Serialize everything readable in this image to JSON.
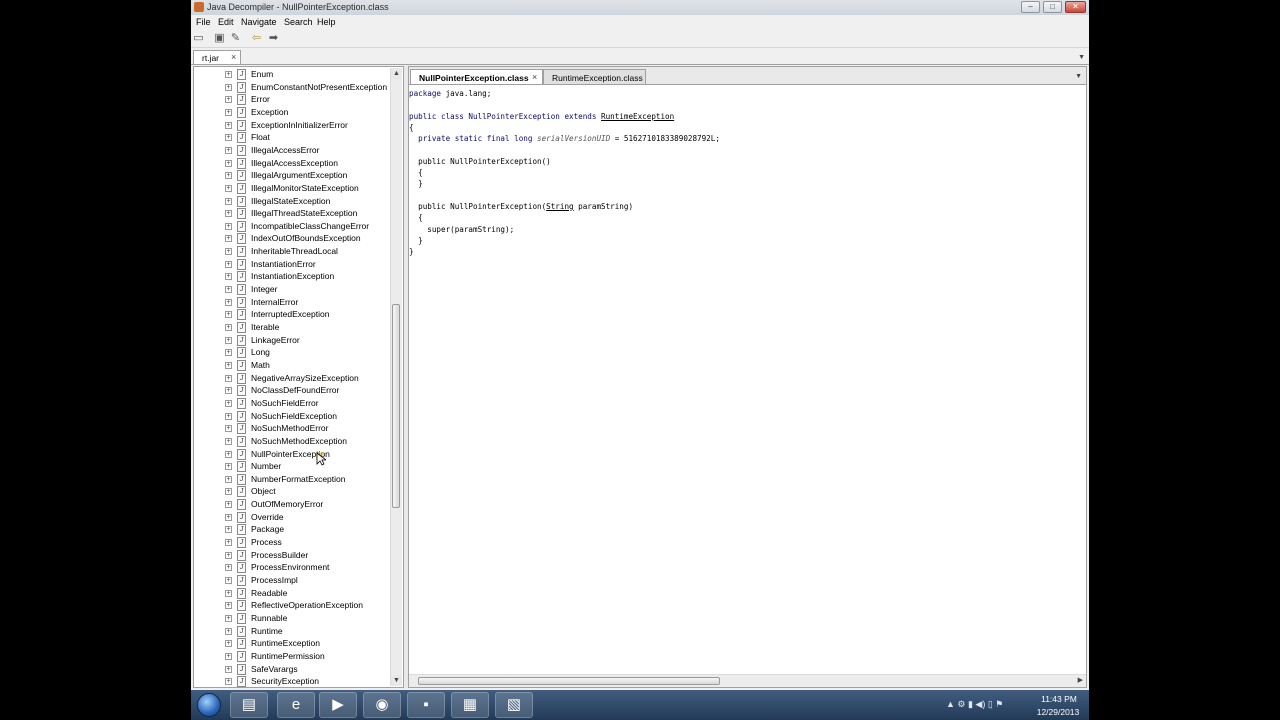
{
  "window": {
    "title": "Java Decompiler - NullPointerException.class"
  },
  "window_controls": {
    "minimize": "–",
    "maximize": "□",
    "close": "✕"
  },
  "menu": [
    "File",
    "Edit",
    "Navigate",
    "Search",
    "Help"
  ],
  "toolbar": [
    {
      "icon": "open-file-icon",
      "glyph": "▭"
    },
    {
      "icon": "open-type-icon",
      "glyph": "▣"
    },
    {
      "icon": "hammer-icon",
      "glyph": "✎"
    },
    {
      "icon": "back-arrow-icon",
      "glyph": "⇦"
    },
    {
      "icon": "forward-arrow-icon",
      "glyph": "➡"
    }
  ],
  "jar_tab": {
    "label": "rt.jar",
    "close": "×"
  },
  "tree": {
    "expander": "+",
    "file_glyph": "J",
    "items": [
      "Enum",
      "EnumConstantNotPresentException",
      "Error",
      "Exception",
      "ExceptionInInitializerError",
      "Float",
      "IllegalAccessError",
      "IllegalAccessException",
      "IllegalArgumentException",
      "IllegalMonitorStateException",
      "IllegalStateException",
      "IllegalThreadStateException",
      "IncompatibleClassChangeError",
      "IndexOutOfBoundsException",
      "InheritableThreadLocal",
      "InstantiationError",
      "InstantiationException",
      "Integer",
      "InternalError",
      "InterruptedException",
      "Iterable",
      "LinkageError",
      "Long",
      "Math",
      "NegativeArraySizeException",
      "NoClassDefFoundError",
      "NoSuchFieldError",
      "NoSuchFieldException",
      "NoSuchMethodError",
      "NoSuchMethodException",
      "NullPointerException",
      "Number",
      "NumberFormatException",
      "Object",
      "OutOfMemoryError",
      "Override",
      "Package",
      "Process",
      "ProcessBuilder",
      "ProcessEnvironment",
      "ProcessImpl",
      "Readable",
      "ReflectiveOperationException",
      "Runnable",
      "Runtime",
      "RuntimeException",
      "RuntimePermission",
      "SafeVarargs",
      "SecurityException"
    ]
  },
  "editor_tabs": [
    {
      "label": "NullPointerException.class",
      "close": "×",
      "active": true
    },
    {
      "label": "RuntimeException.class",
      "close": "",
      "active": false
    }
  ],
  "code": {
    "package_kw": "package",
    "package_name": " java.lang;",
    "class_decl": "public class NullPointerException extends ",
    "class_super": "RuntimeException",
    "open_brace": "{",
    "field_prefix": "  private static final long ",
    "field_name": "serialVersionUID",
    "field_value": " = 5162710183389028792L;",
    "ctor1": "  public NullPointerException()",
    "ctor1_open": "  {",
    "ctor1_close": "  }",
    "ctor2_prefix": "  public NullPointerException(",
    "ctor2_type": "String",
    "ctor2_suffix": " paramString)",
    "ctor2_open": "  {",
    "ctor2_body": "    super(paramString);",
    "ctor2_close": "  }",
    "close_brace": "}"
  },
  "scroll_arrows": {
    "up": "▲",
    "down": "▼"
  },
  "taskbar": {
    "apps": [
      {
        "icon": "file-explorer-icon",
        "glyph": "▤"
      },
      {
        "icon": "internet-explorer-icon",
        "glyph": "e"
      },
      {
        "icon": "media-player-icon",
        "glyph": "▶"
      },
      {
        "icon": "firefox-icon",
        "glyph": "◉"
      },
      {
        "icon": "save-disk-icon",
        "glyph": "▪"
      },
      {
        "icon": "java-decompiler-icon",
        "glyph": "▦"
      },
      {
        "icon": "clipboard-app-icon",
        "glyph": "▧"
      }
    ],
    "tray": "▲ ⚙ ▮ ◀) ▯ ⚑",
    "time": "11:43 PM",
    "date": "12/29/2013"
  }
}
